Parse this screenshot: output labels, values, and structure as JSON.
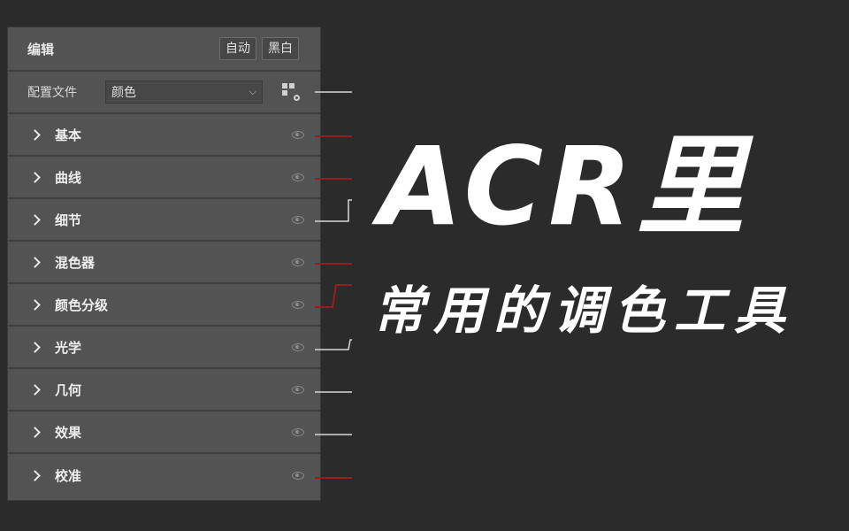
{
  "panel": {
    "title": "编辑",
    "buttons": {
      "auto": "自动",
      "bw": "黑白"
    },
    "profile": {
      "label": "配置文件",
      "value": "颜色"
    },
    "sections": [
      {
        "label": "基本",
        "leader": "#9b1c1c"
      },
      {
        "label": "曲线",
        "leader": "#9b1c1c"
      },
      {
        "label": "细节",
        "leader": "#d8d8d8"
      },
      {
        "label": "混色器",
        "leader": "#9b1c1c"
      },
      {
        "label": "颜色分级",
        "leader": "#9b1c1c"
      },
      {
        "label": "光学",
        "leader": "#d8d8d8"
      },
      {
        "label": "几何",
        "leader": "#d8d8d8"
      },
      {
        "label": "效果",
        "leader": "#d8d8d8"
      },
      {
        "label": "校准",
        "leader": "#9b1c1c"
      }
    ]
  },
  "overlay": {
    "title": "ACR里",
    "subtitle": "常用的调色工具"
  },
  "colors": {
    "background": "#2b2b2b",
    "panel": "#535353",
    "leader_red": "#9b1c1c",
    "leader_white": "#d8d8d8"
  }
}
